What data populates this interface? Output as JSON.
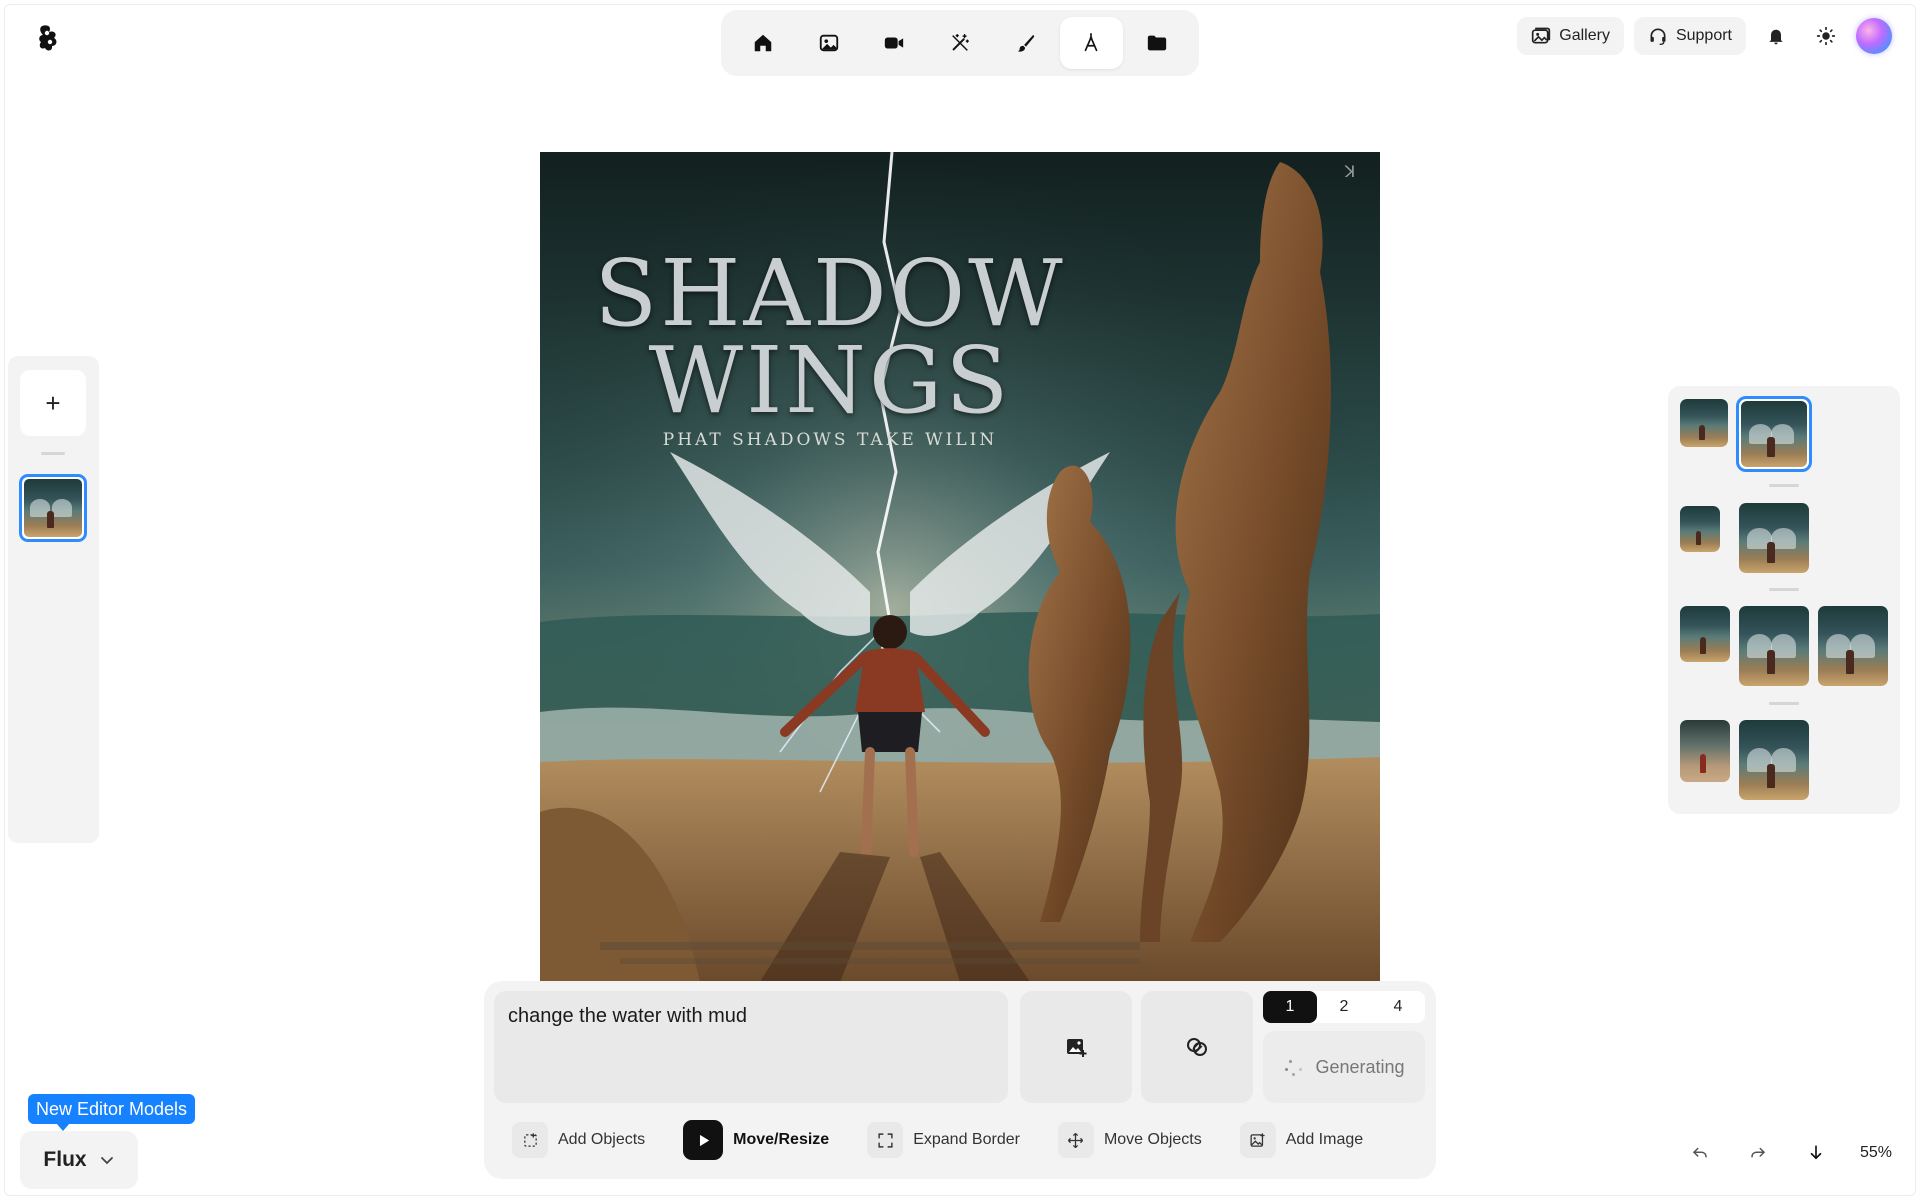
{
  "top_toolbar": {
    "items": [
      {
        "icon": "home-icon"
      },
      {
        "icon": "image-icon"
      },
      {
        "icon": "video-icon"
      },
      {
        "icon": "magic-wand-icon"
      },
      {
        "icon": "brush-icon"
      },
      {
        "icon": "pen-nib-icon",
        "active": true
      },
      {
        "icon": "folder-icon"
      }
    ]
  },
  "header": {
    "gallery_label": "Gallery",
    "support_label": "Support"
  },
  "canvas": {
    "title_line1": "SHADOW",
    "title_line2": "WINGS",
    "tagline": "PHAT SHADOWS TAKE WILIN"
  },
  "left_panel": {
    "add_label": "+"
  },
  "model": {
    "badge": "New Editor Models",
    "selected": "Flux"
  },
  "prompt": {
    "value": "change the water with mud"
  },
  "count_options": [
    "1",
    "2",
    "4"
  ],
  "generate": {
    "label": "Generating"
  },
  "tools": [
    {
      "label": "Add Objects",
      "icon": "add-objects-icon"
    },
    {
      "label": "Move/Resize",
      "icon": "play-icon",
      "active": true
    },
    {
      "label": "Expand Border",
      "icon": "expand-icon"
    },
    {
      "label": "Move Objects",
      "icon": "move-icon"
    },
    {
      "label": "Add Image",
      "icon": "add-image-icon"
    }
  ],
  "footer": {
    "zoom": "55%"
  },
  "colors": {
    "accent": "#1682ff",
    "selection": "#2f8cff",
    "panel": "#f3f3f3"
  }
}
